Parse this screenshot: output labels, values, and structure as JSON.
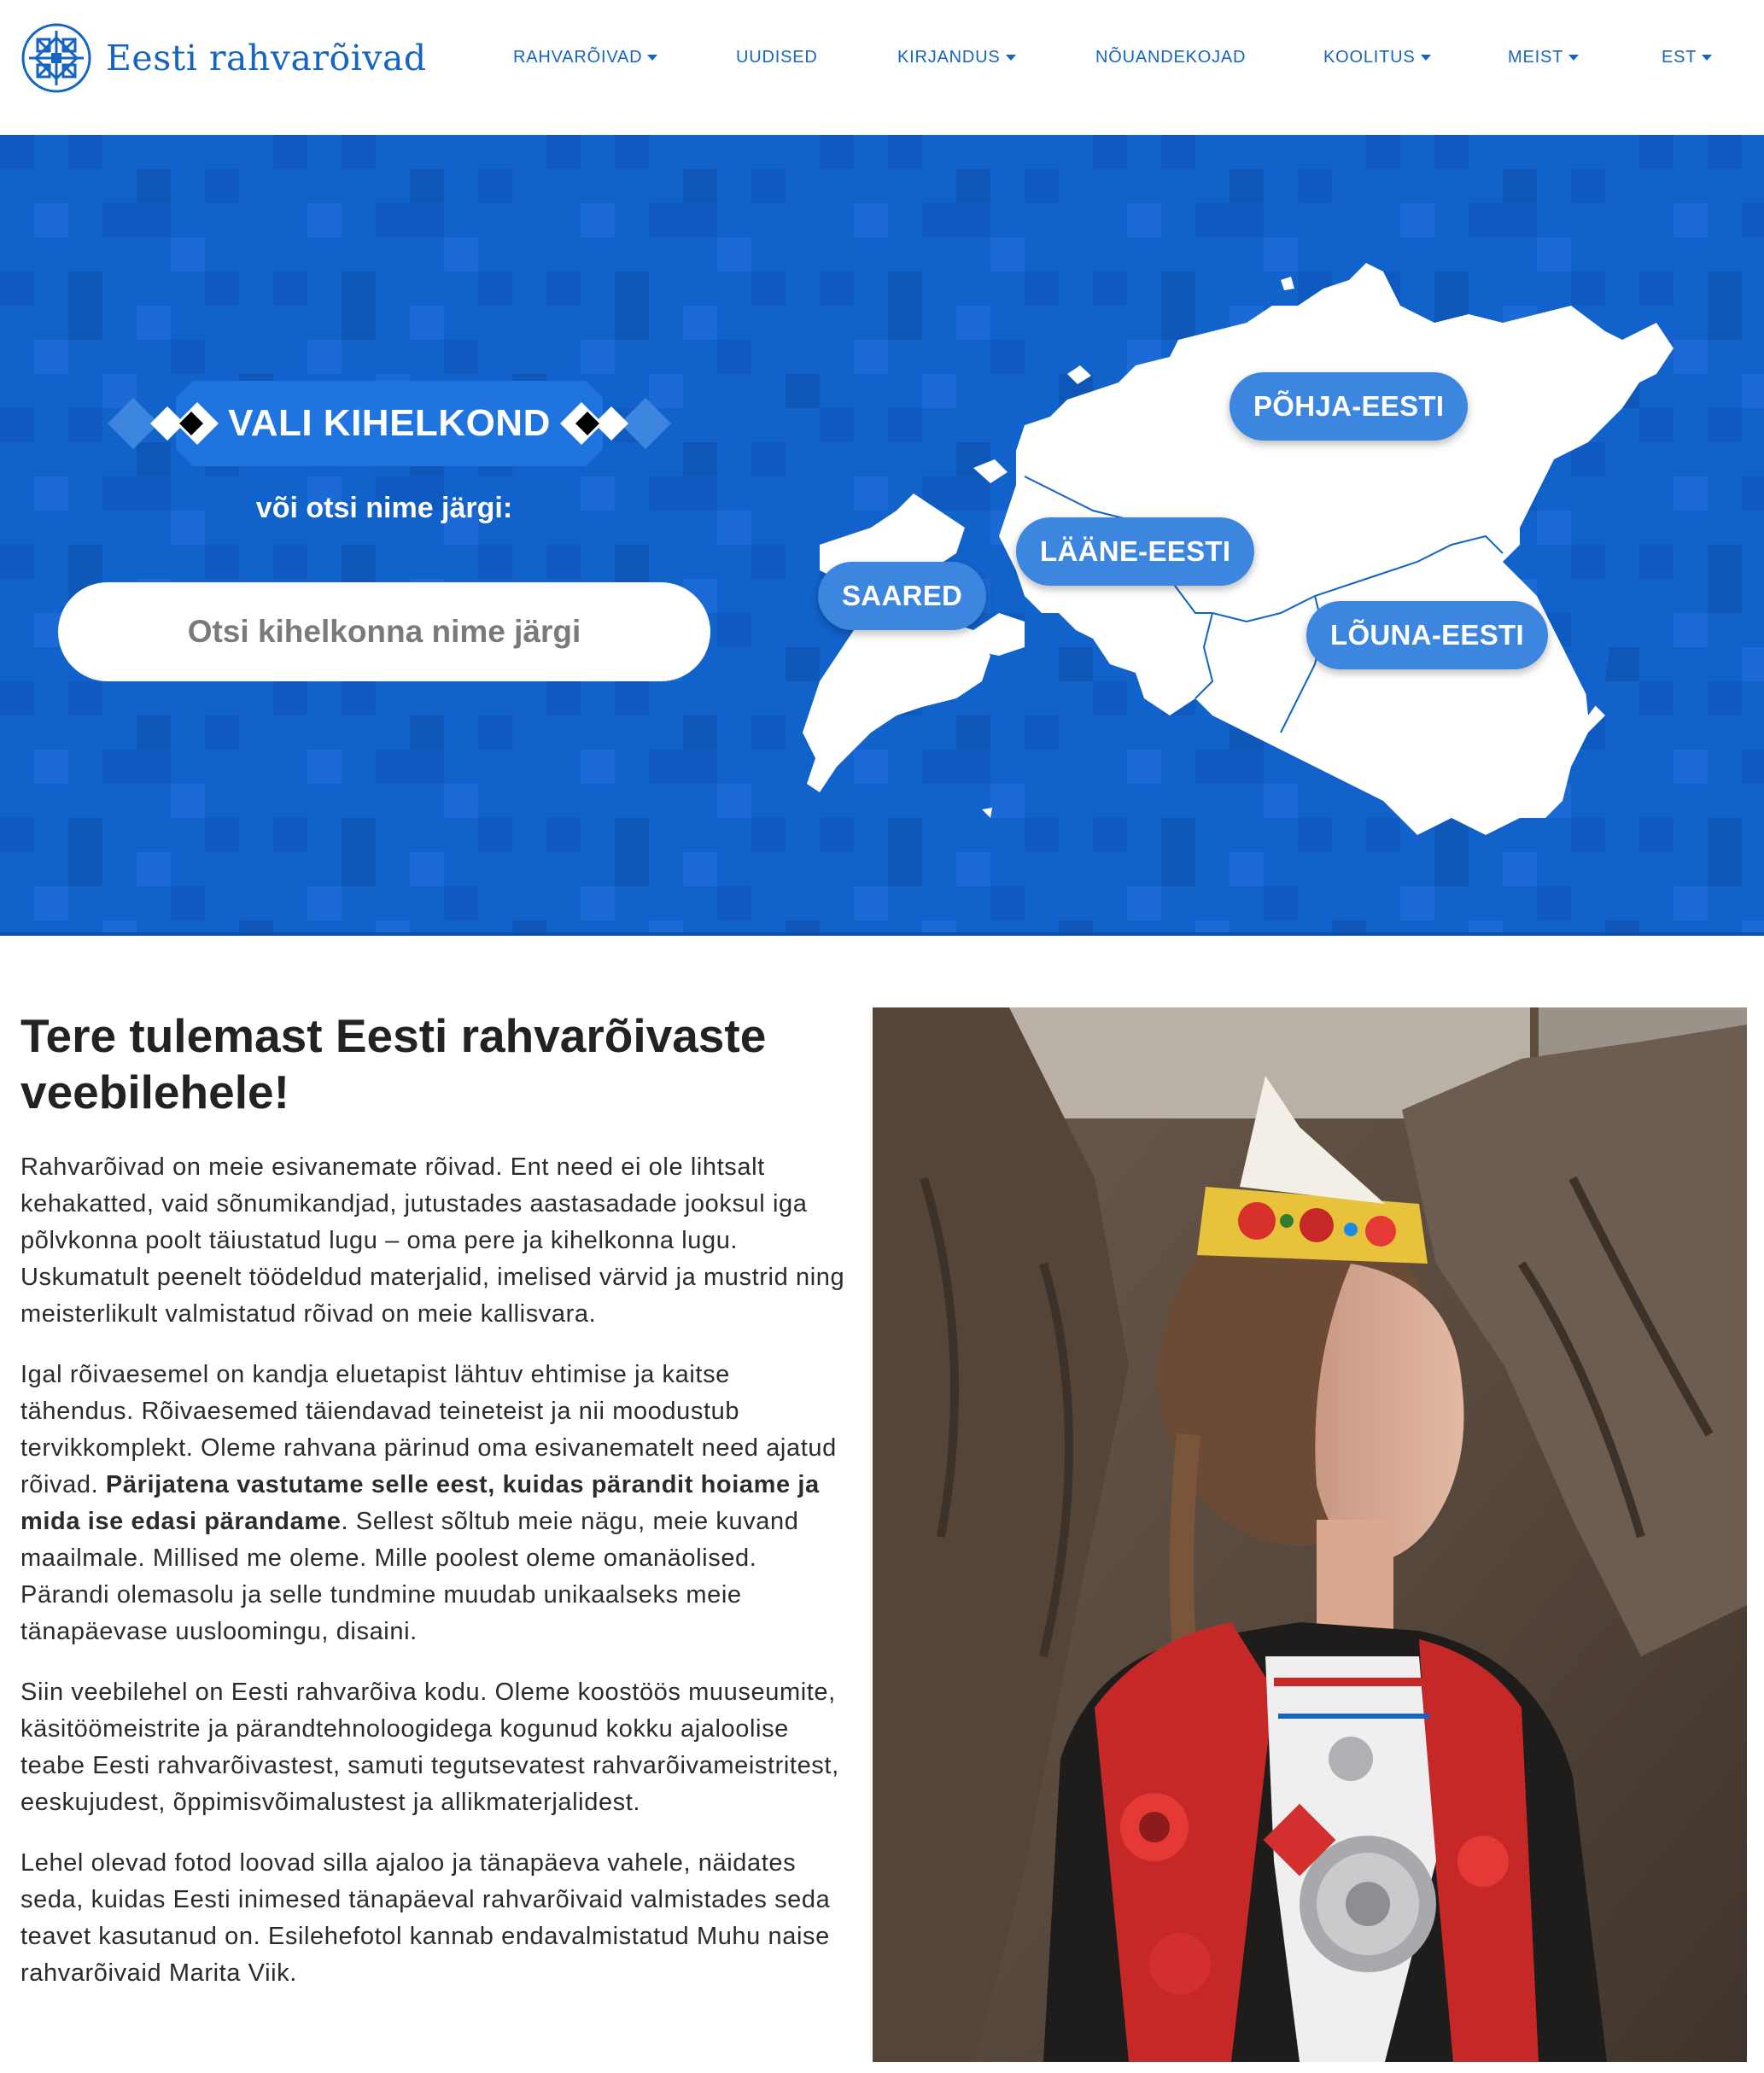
{
  "header": {
    "logo_text": "Eesti rahvarõivad",
    "nav": [
      {
        "label": "RAHVARÕIVAD",
        "dropdown": true
      },
      {
        "label": "UUDISED",
        "dropdown": false
      },
      {
        "label": "KIRJANDUS",
        "dropdown": true
      },
      {
        "label": "NÕUANDEKOJAD",
        "dropdown": false
      },
      {
        "label": "KOOLITUS",
        "dropdown": true
      },
      {
        "label": "MEIST",
        "dropdown": true
      },
      {
        "label": "EST",
        "dropdown": true
      }
    ]
  },
  "hero": {
    "banner_label": "VALI KIHELKOND",
    "or_search": "või otsi nime järgi:",
    "search_placeholder": "Otsi kihelkonna nime järgi",
    "regions": [
      "PÕHJA-EESTI",
      "LÄÄNE-EESTI",
      "SAARED",
      "LÕUNA-EESTI"
    ]
  },
  "welcome": {
    "title": "Tere tulemast Eesti rahvarõivaste veebilehele!",
    "paragraph1": "Rahvarõivad on meie esivanemate rõivad. Ent need ei ole lihtsalt kehakatted, vaid sõnumikandjad, jutustades aastasadade jooksul iga põlvkonna poolt täiustatud lugu – oma pere ja kihelkonna lugu. Uskumatult peenelt töödeldud materjalid, imelised värvid ja mustrid ning meisterlikult valmistatud rõivad on meie kallisvara.",
    "paragraph2_before": "Igal rõivaesemel on kandja eluetapist lähtuv ehtimise ja kaitse tähendus. Rõivaesemed täiendavad teineteist ja nii moodustub tervikkomplekt. Oleme rahvana pärinud oma esivanematelt need ajatud rõivad. ",
    "paragraph2_bold": "Pärijatena vastutame selle eest, kuidas pärandit hoiame ja mida ise edasi pärandame",
    "paragraph2_after": ". Sellest sõltub meie nägu, meie kuvand maailmale. Millised me oleme. Mille poolest oleme omanäolised. Pärandi olemasolu ja selle tundmine muudab unikaalseks meie tänapäevase uusloomingu, disaini.",
    "paragraph3": "Siin veebilehel on Eesti rahvarõiva kodu. Oleme koostöös muuseumite, käsitöömeistrite ja pärandtehnoloogidega kogunud kokku ajaloolise teabe Eesti rahvarõivastest, samuti tegutsevatest rahvarõivameistritest, eeskujudest, õppimisvõimalustest ja allikmaterjalidest.",
    "paragraph4": "Lehel olevad fotod loovad silla ajaloo ja tänapäeva vahele, näidates seda, kuidas Eesti inimesed tänapäeval rahvarõivaid valmistades seda teavet kasutanud on. Esilehefotol kannab endavalmistatud Muhu naise rahvarõivaid Marita Viik."
  },
  "colors": {
    "brand_blue": "#1565c0",
    "hero_blue": "#1262cc",
    "region_button": "#3d86e0"
  }
}
